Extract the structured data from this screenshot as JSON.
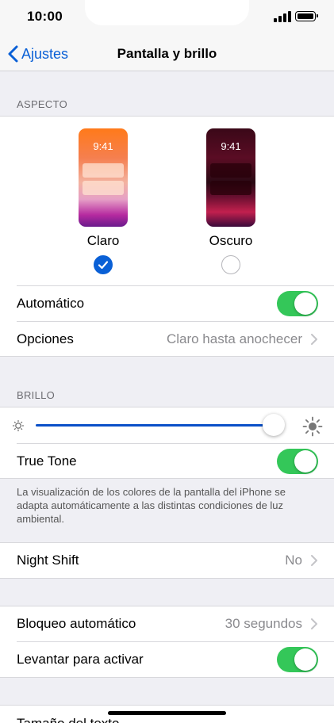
{
  "status_bar": {
    "time": "10:00"
  },
  "nav": {
    "back_label": "Ajustes",
    "title": "Pantalla y brillo"
  },
  "appearance": {
    "section_title": "ASPECTO",
    "light": {
      "label": "Claro",
      "preview_time": "9:41",
      "selected": true
    },
    "dark": {
      "label": "Oscuro",
      "preview_time": "9:41",
      "selected": false
    },
    "automatic": {
      "label": "Automático",
      "on": true
    },
    "options": {
      "label": "Opciones",
      "value": "Claro hasta anochecer"
    }
  },
  "brightness": {
    "section_title": "BRILLO",
    "level": 0.96,
    "true_tone": {
      "label": "True Tone",
      "on": true
    },
    "true_tone_footer": "La visualización de los colores de la pantalla del iPhone se adapta automáticamente a las distintas condiciones de luz ambiental."
  },
  "night_shift": {
    "label": "Night Shift",
    "value": "No"
  },
  "auto_lock": {
    "label": "Bloqueo automático",
    "value": "30 segundos"
  },
  "raise_to_wake": {
    "label": "Levantar para activar",
    "on": true
  },
  "text_size": {
    "label": "Tamaño del texto"
  },
  "colors": {
    "accent": "#0a60d6",
    "toggle_on": "#34c759",
    "slider": "#0a50c8"
  }
}
